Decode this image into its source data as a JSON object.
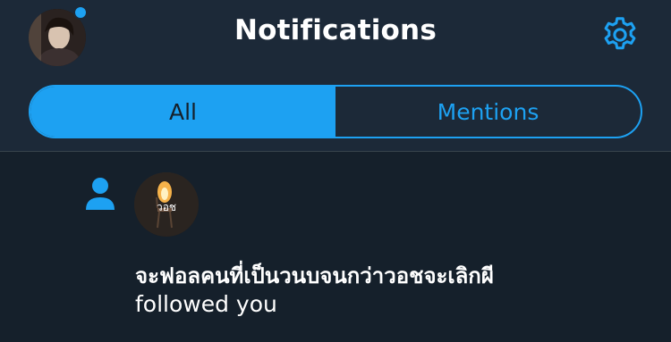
{
  "header": {
    "title": "Notifications",
    "unread_dot": true
  },
  "tabs": [
    {
      "label": "All",
      "selected": true
    },
    {
      "label": "Mentions",
      "selected": false
    }
  ],
  "notification": {
    "type_icon": "person-icon",
    "avatar_caption": "วอช",
    "user_name": "จะฟอลคนที่เป็นวนบจนกว่าวอชจะเลิกผี",
    "action_text": "followed you"
  },
  "colors": {
    "accent": "#1da1f2",
    "header_bg": "#1c2938",
    "content_bg": "#15202b",
    "text": "#ffffff"
  }
}
